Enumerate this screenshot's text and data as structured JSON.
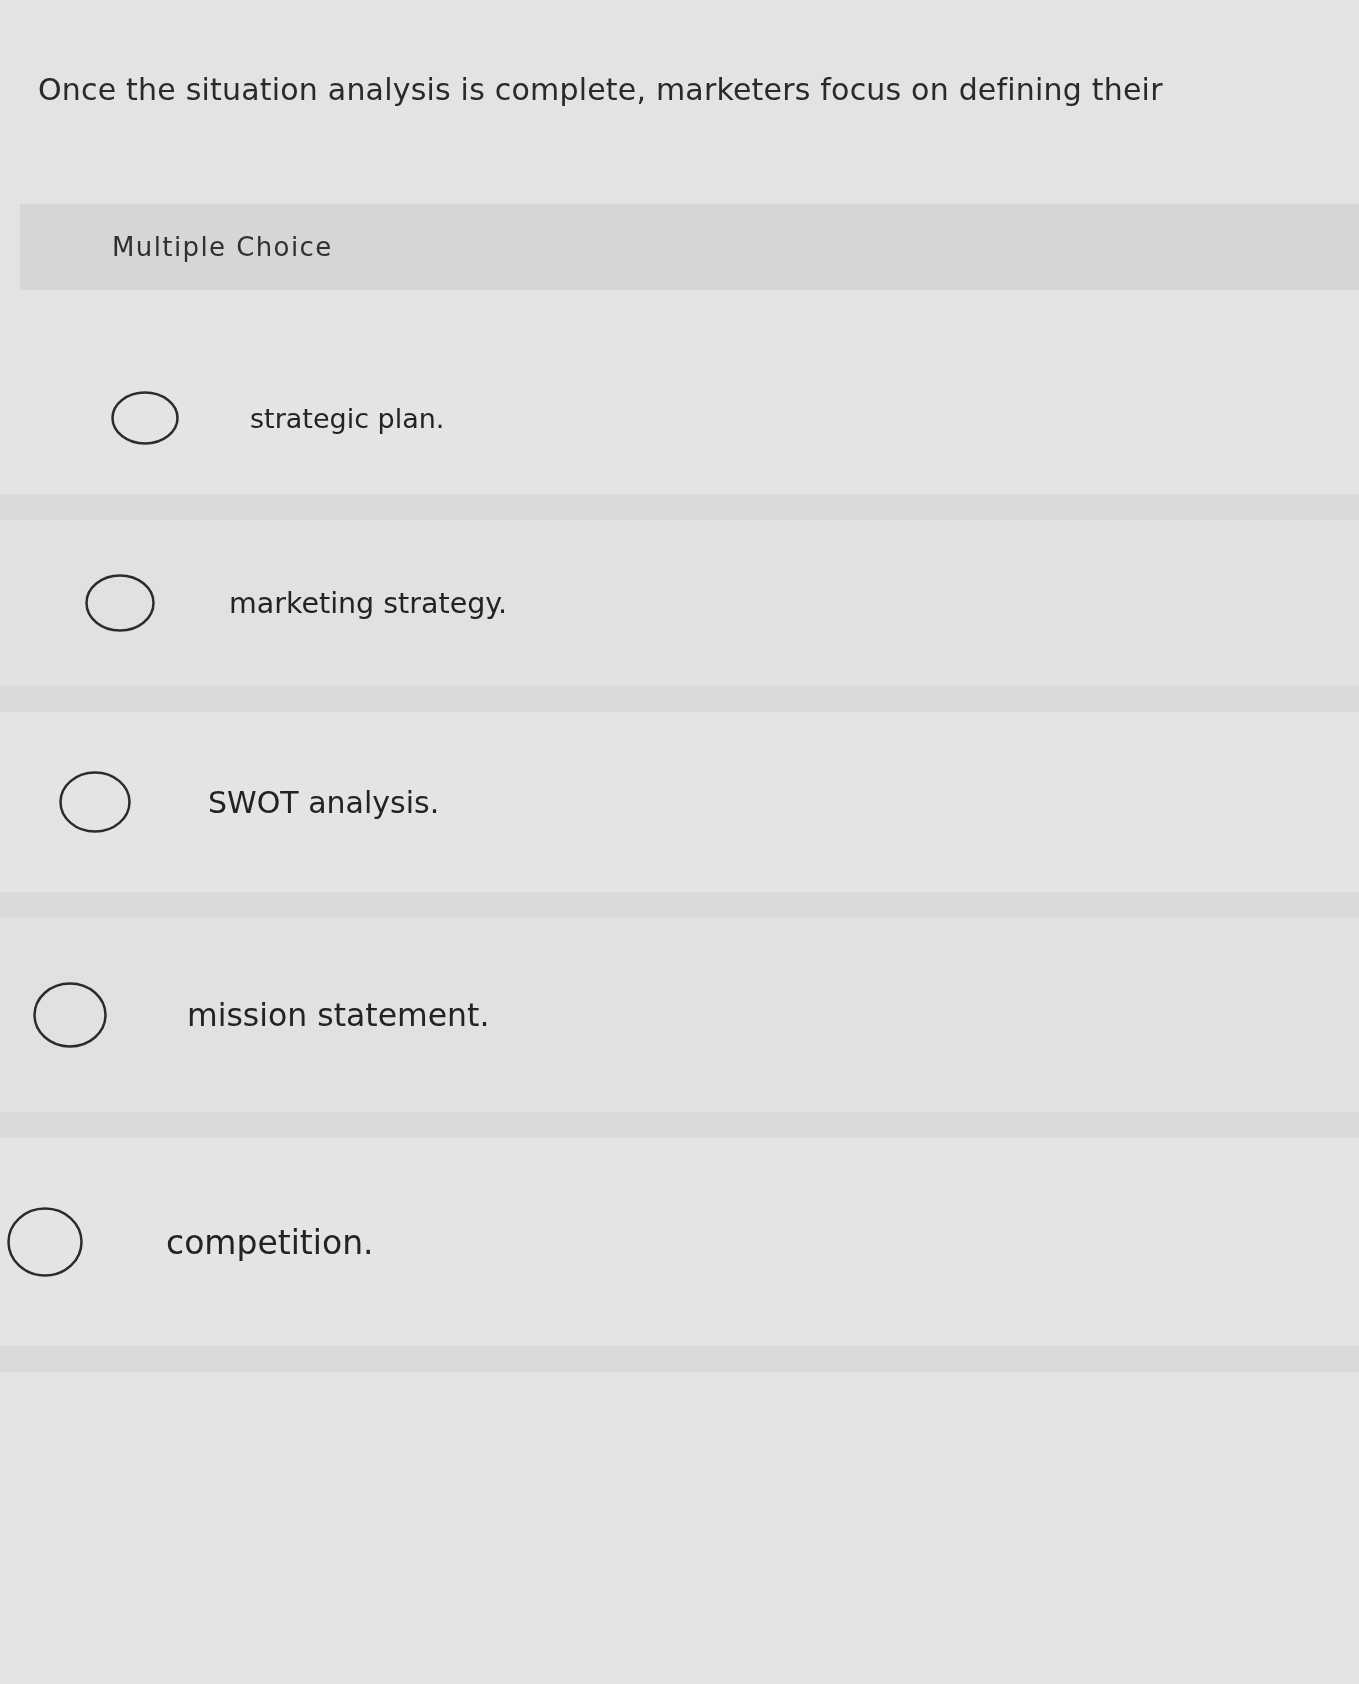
{
  "question": {
    "text": "Once the situation analysis is complete, marketers focus on defining their"
  },
  "question_type": {
    "label": "Multiple Choice"
  },
  "options": [
    {
      "label": "strategic plan.",
      "selected": false
    },
    {
      "label": "marketing strategy.",
      "selected": false
    },
    {
      "label": "SWOT analysis.",
      "selected": false
    },
    {
      "label": "mission statement.",
      "selected": false
    },
    {
      "label": "competition.",
      "selected": false
    }
  ]
}
